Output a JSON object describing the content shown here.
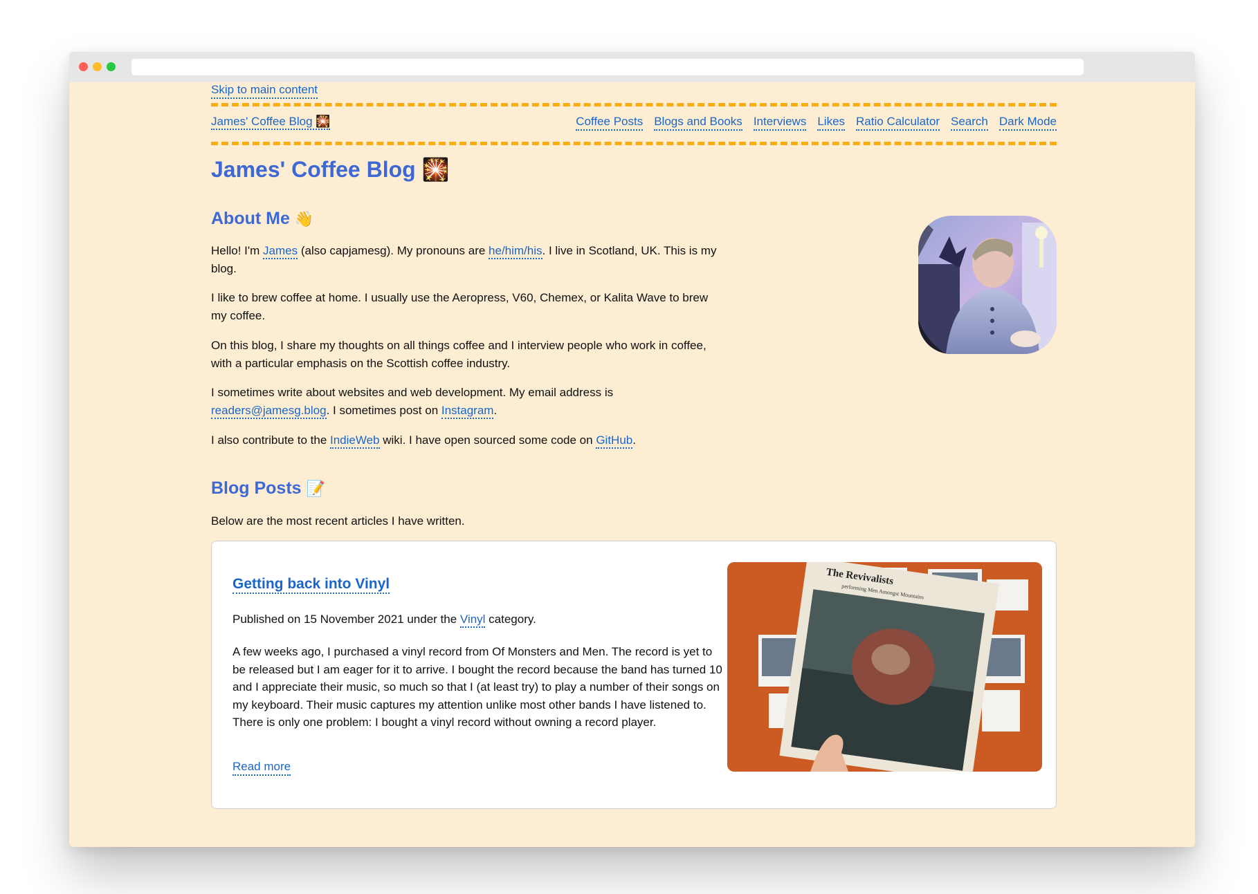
{
  "skip_link": "Skip to main content",
  "nav": {
    "site_name": "James' Coffee Blog",
    "site_emoji": "🎇",
    "links": [
      "Coffee Posts",
      "Blogs and Books",
      "Interviews",
      "Likes",
      "Ratio Calculator",
      "Search",
      "Dark Mode"
    ]
  },
  "page_title": "James' Coffee Blog",
  "page_title_emoji": "🎇",
  "about": {
    "heading": "About Me",
    "emoji": "👋",
    "p1": {
      "a": "Hello! I'm ",
      "link1": "James",
      "b": " (also capjamesg). My pronouns are ",
      "link2": "he/him/his",
      "c": ". I live in Scotland, UK. This is my blog."
    },
    "p2": "I like to brew coffee at home. I usually use the Aeropress, V60, Chemex, or Kalita Wave to brew my coffee.",
    "p3": "On this blog, I share my thoughts on all things coffee and I interview people who work in coffee, with a particular emphasis on the Scottish coffee industry.",
    "p4": {
      "a": "I sometimes write about websites and web development. My email address is ",
      "link1": "readers@jamesg.blog",
      "b": ". I sometimes post on ",
      "link2": "Instagram",
      "c": "."
    },
    "p5": {
      "a": "I also contribute to the ",
      "link1": "IndieWeb",
      "b": " wiki. I have open sourced some code on ",
      "link2": "GitHub",
      "c": "."
    }
  },
  "posts": {
    "heading": "Blog Posts",
    "emoji": "📝",
    "intro": "Below are the most recent articles I have written.",
    "card": {
      "title": "Getting back into Vinyl",
      "meta_a": "Published on 15 November 2021 under the ",
      "meta_link": "Vinyl",
      "meta_b": " category.",
      "body": "A few weeks ago, I purchased a vinyl record from Of Monsters and Men. The record is yet to be released but I am eager for it to arrive. I bought the record because the band has turned 10 and I appreciate their music, so much so that I (at least try) to play a number of their songs on my keyboard. Their music captures my attention unlike most other bands I have listened to. There is only one problem: I bought a vinyl record without owning a record player.",
      "read_more": "Read more",
      "image": {
        "record_title": "The Revivalists",
        "record_subtitle": "performing Men Amongst Mountains"
      }
    }
  }
}
